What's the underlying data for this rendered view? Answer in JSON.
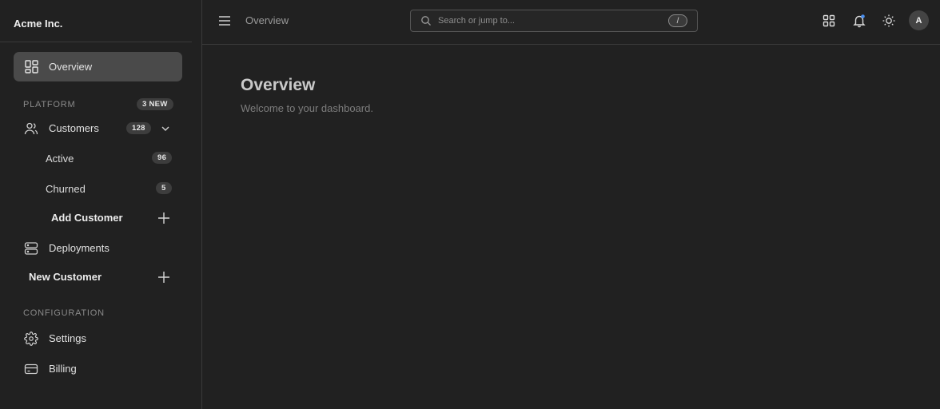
{
  "app": {
    "brand": "Acme Inc."
  },
  "sidebar": {
    "overview": {
      "label": "Overview",
      "icon": "dashboard-icon"
    },
    "platform": {
      "label": "PLATFORM",
      "badge": "3 NEW"
    },
    "customers": {
      "label": "Customers",
      "count": "128",
      "icon": "users-icon",
      "children": [
        {
          "label": "Active",
          "count": "96"
        },
        {
          "label": "Churned",
          "count": "5"
        }
      ],
      "add_label": "Add Customer"
    },
    "deployments": {
      "label": "Deployments",
      "icon": "server-icon"
    },
    "new_customer": {
      "label": "New Customer"
    },
    "configuration": {
      "label": "CONFIGURATION"
    },
    "settings": {
      "label": "Settings",
      "icon": "gear-icon"
    },
    "billing": {
      "label": "Billing",
      "icon": "credit-card-icon"
    }
  },
  "topbar": {
    "breadcrumb": "Overview",
    "search": {
      "placeholder": "Search or jump to...",
      "shortcut": "/"
    },
    "avatar_initial": "A"
  },
  "main": {
    "title": "Overview",
    "subtitle": "Welcome to your dashboard."
  },
  "colors": {
    "background": "#212121",
    "active_item": "#4a4a4a",
    "notification_dot": "#4a8ff0"
  }
}
